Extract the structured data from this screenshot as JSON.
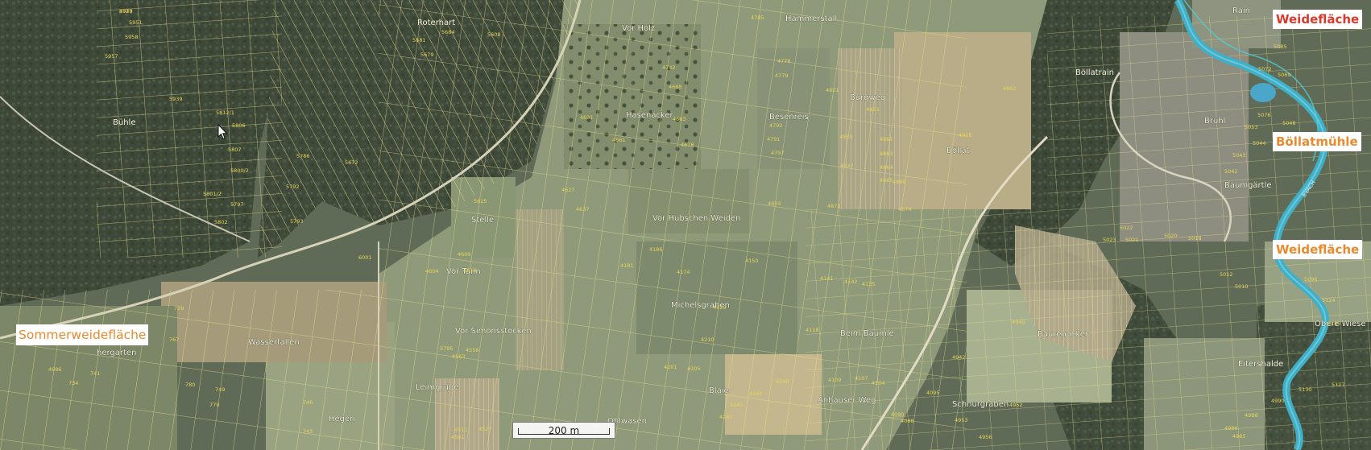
{
  "colors": {
    "forest": "#3f4a3a",
    "field_light": "#b9ad86",
    "field_green": "#8e9a7a",
    "meadow": "#94a184",
    "parcel_line": "#ecdf8f",
    "parcel_number": "#e8d45a",
    "river": "#3fb0c7",
    "callout_orange": "#e98a2e",
    "callout_red": "#d83a2c"
  },
  "place_labels": [
    "Bühle",
    "Roterhart",
    "Vor Holz",
    "Hammerstall",
    "Hasenäcker",
    "Besenreis",
    "Burgweg",
    "Böllatrain",
    "Böllat",
    "Brühl",
    "Baumgärtle",
    "Stelle",
    "Vor Hubschen Weiden",
    "Vor Tann",
    "Michelsgraben",
    "Beim Baumle",
    "Baurenacker",
    "Obere Wiese",
    "Wasserfallen",
    "Vor Simonsstöcken",
    "Leimgrube",
    "Blaie",
    "Anhauser Weg",
    "Schnurgraben",
    "Eitershalde",
    "Hegen",
    "Ohlwasen",
    "Rain",
    "hergarten"
  ],
  "parcel_numbers": [
    "5943",
    "5951",
    "5958",
    "5957",
    "5939",
    "5812/1",
    "5806",
    "5807",
    "5800/2",
    "5801/2",
    "5797",
    "5802",
    "5793",
    "5792",
    "5786",
    "5672",
    "5681",
    "5684",
    "5679",
    "5608",
    "4785",
    "4778",
    "4779",
    "4742",
    "4688",
    "4663",
    "4678",
    "4637",
    "4792",
    "4797",
    "4791",
    "4821",
    "4823",
    "4835",
    "4837",
    "4862",
    "4863",
    "4864",
    "4865",
    "4872",
    "4874",
    "4889",
    "4902",
    "4928",
    "4933",
    "4661",
    "4631",
    "4627",
    "5625",
    "4604",
    "4609",
    "4610",
    "4181",
    "4186",
    "4150",
    "4141",
    "4142",
    "4135",
    "4174",
    "4129",
    "4118",
    "4109",
    "4107",
    "4104",
    "4090",
    "4095",
    "4088",
    "4240",
    "4242",
    "4245",
    "4201",
    "4205",
    "4210",
    "4247",
    "4953",
    "4956",
    "4952",
    "4942",
    "4940",
    "5021",
    "5020",
    "5022",
    "5023",
    "5018",
    "5012",
    "5010",
    "5042",
    "5043",
    "5044",
    "5046",
    "5048",
    "5053",
    "5076",
    "5069",
    "5072",
    "5085",
    "5096",
    "5124",
    "5127",
    "5133",
    "5130",
    "4990",
    "4988",
    "4986",
    "4985",
    "4986",
    "734",
    "741",
    "743",
    "746",
    "749",
    "779",
    "780",
    "767",
    "729",
    "6001",
    "5795",
    "4563",
    "4558",
    "4561",
    "4511",
    "4527",
    "4529"
  ],
  "river_name": "EYACH",
  "callouts": {
    "sommerweideflaeche": "Sommerweidefläche",
    "weideflaeche_top": "Weidefläche",
    "boellatmuehle": "Böllatmühle",
    "weideflaeche_mid": "Weidefläche"
  },
  "scale": {
    "label": "200 m"
  }
}
